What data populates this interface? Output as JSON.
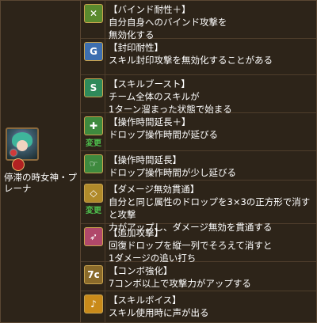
{
  "monster": {
    "name": "停滞の時女神・プレーナ"
  },
  "awakenings": [
    {
      "title": "【バインド耐性＋】",
      "desc": "自分自身へのバインド攻撃を\n無効化する",
      "changed": false,
      "icon": "bind-resist-plus-icon",
      "color": "#5a8a2e",
      "glyph": "✕"
    },
    {
      "title": "【封印耐性】",
      "desc": "スキル封印攻撃を無効化することがある",
      "changed": false,
      "icon": "skill-bind-resist-icon",
      "color": "#3d6fb0",
      "glyph": "G"
    },
    {
      "title": "【スキルブースト】",
      "desc": "チーム全体のスキルが\n1ターン溜まった状態で始まる",
      "changed": false,
      "icon": "skill-boost-icon",
      "color": "#2e8a5a",
      "glyph": "S"
    },
    {
      "title": "【操作時間延長＋】",
      "desc": "ドロップ操作時間が延びる",
      "changed": true,
      "change_label": "変更",
      "icon": "time-extend-plus-icon",
      "color": "#3e8a3e",
      "glyph": "✚"
    },
    {
      "title": "【操作時間延長】",
      "desc": "ドロップ操作時間が少し延びる",
      "changed": false,
      "icon": "time-extend-icon",
      "color": "#3e8a3e",
      "glyph": "☞"
    },
    {
      "title": "【ダメージ無効貫通】",
      "desc": "自分と同じ属性のドロップを3×3の正方形で消すと攻撃\n力がアップし、ダメージ無効を貫通する",
      "changed": true,
      "change_label": "変更",
      "icon": "void-damage-pierce-icon",
      "color": "#b08a2a",
      "glyph": "◇"
    },
    {
      "title": "【追加攻撃】",
      "desc": "回復ドロップを縦一列でそろえて消すと\n1ダメージの追い打ち",
      "changed": false,
      "icon": "extra-attack-icon",
      "color": "#b0486a",
      "glyph": "➶"
    },
    {
      "title": "【コンボ強化】",
      "desc": "7コンボ以上で攻撃力がアップする",
      "changed": false,
      "icon": "combo-boost-icon",
      "color": "#8a6a2a",
      "glyph": "7c"
    },
    {
      "title": "【スキルボイス】",
      "desc": "スキル使用時に声が出る",
      "changed": false,
      "icon": "skill-voice-icon",
      "color": "#c98a1a",
      "glyph": "♪"
    }
  ]
}
